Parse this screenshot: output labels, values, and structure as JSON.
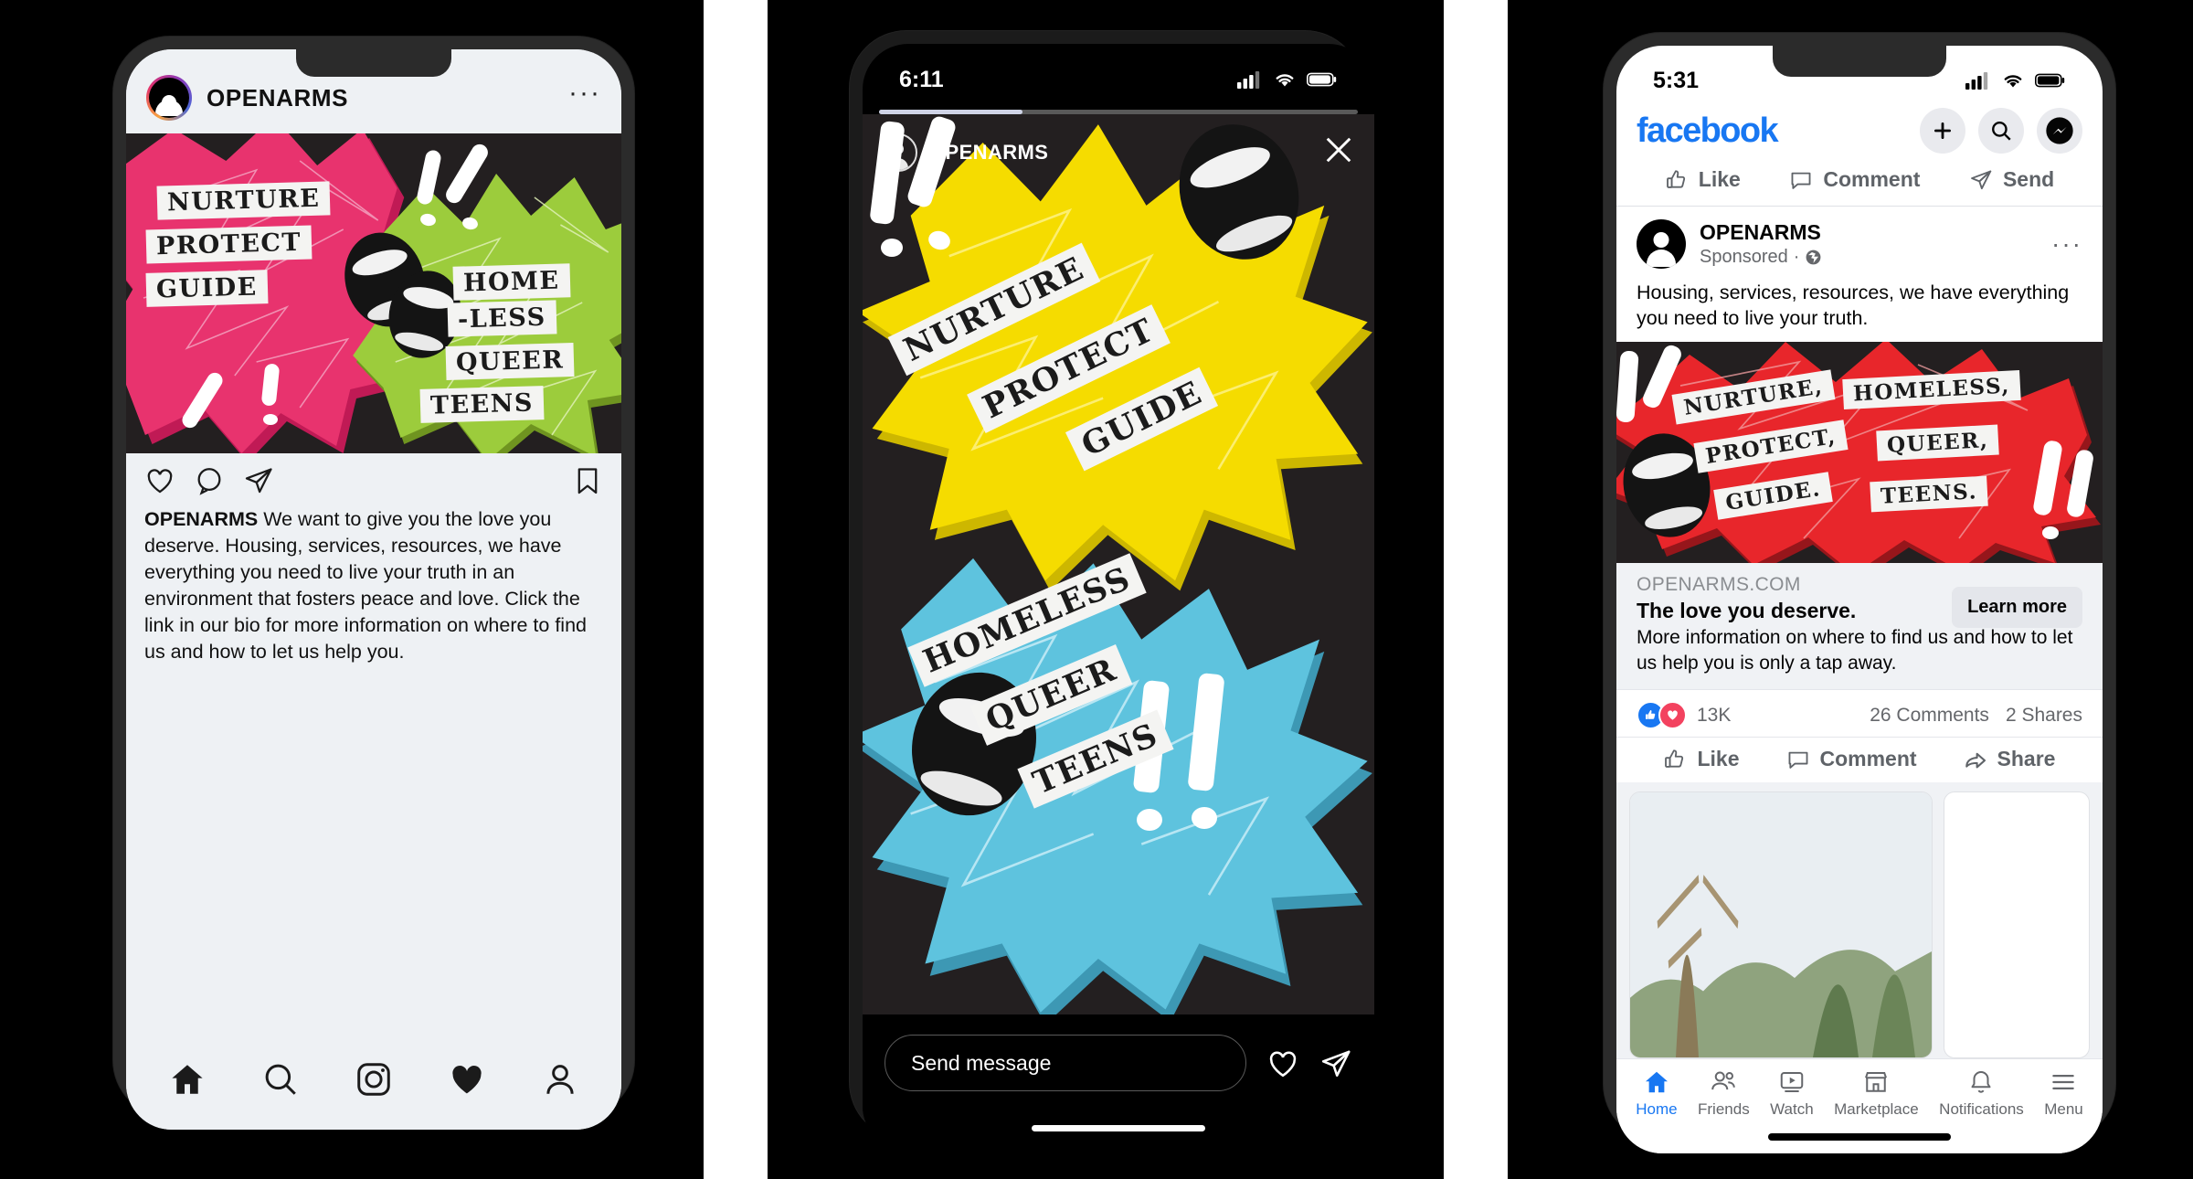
{
  "panels": {
    "instagram": {
      "name": "Instagram feed post mockup"
    },
    "story": {
      "name": "Instagram story mockup"
    },
    "facebook": {
      "name": "Facebook sponsored post mockup"
    }
  },
  "instagram": {
    "header": {
      "username": "OPENARMS",
      "more_label": "···"
    },
    "post": {
      "artwork": {
        "words_left": [
          "NURTURE",
          "PROTECT",
          "GUIDE"
        ],
        "words_right": [
          "HOME",
          "-LESS",
          "QUEER",
          "TEENS"
        ],
        "burst_left_color": "#e8336e",
        "burst_right_color": "#9ccc3c",
        "background_color": "#231f20"
      },
      "caption_author": "OPENARMS",
      "caption_body": " We want to give you the love you deserve. Housing, services, resources, we have everything you need to live your truth in an environment that fosters peace and love. Click the link in our bio for more information on where to find us and how to let us help you."
    },
    "actions": [
      "like-icon",
      "comment-icon",
      "share-icon",
      "bookmark-icon"
    ],
    "nav": [
      "home-icon",
      "search-icon",
      "reels-icon",
      "heart-icon",
      "profile-icon"
    ]
  },
  "story": {
    "status": {
      "time": "6:11",
      "signal": "signal-icon",
      "wifi": "wifi-icon",
      "battery": "battery-icon"
    },
    "progress_percent": 30,
    "header": {
      "username": "OPENARMS",
      "close_label": "✕"
    },
    "artwork": {
      "words_top": [
        "NURTURE",
        "PROTECT",
        "GUIDE"
      ],
      "words_bottom": [
        "HOMELESS",
        "QUEER",
        "TEENS"
      ],
      "burst_top_color": "#f5dc00",
      "burst_bottom_color": "#5ec3de",
      "background_color": "#231f20"
    },
    "footer": {
      "input_placeholder": "Send message",
      "like_icon": "heart-icon",
      "send_icon": "send-icon"
    }
  },
  "facebook": {
    "status": {
      "time": "5:31",
      "signal": "signal-icon",
      "wifi": "wifi-icon",
      "battery": "battery-icon"
    },
    "topbar": {
      "logo": "facebook",
      "add_icon": "plus-icon",
      "search_icon": "search-icon",
      "messenger_icon": "messenger-icon"
    },
    "quickbar": [
      {
        "icon": "thumbs-up-icon",
        "label": "Like"
      },
      {
        "icon": "comment-icon",
        "label": "Comment"
      },
      {
        "icon": "send-icon",
        "label": "Send"
      }
    ],
    "post": {
      "page_name": "OPENARMS",
      "sponsored_label": "Sponsored",
      "privacy_separator": "·",
      "privacy_icon": "globe-icon",
      "more_label": "···",
      "body": "Housing, services, resources, we have everything you need to live your truth.",
      "artwork": {
        "words_left": [
          "NURTURE,",
          "PROTECT,",
          "GUIDE."
        ],
        "words_right": [
          "HOMELESS,",
          "QUEER,",
          "TEENS."
        ],
        "burst_color": "#e8262b",
        "background_color": "#231f20"
      }
    },
    "link_card": {
      "domain": "OPENARMS.COM",
      "title": "The love you deserve.",
      "description": "More information on where to find us and how to let us help you is only a tap away.",
      "cta": "Learn more"
    },
    "stats": {
      "reaction_count": "13K",
      "comments": "26 Comments",
      "shares": "2 Shares"
    },
    "actions": [
      {
        "icon": "thumbs-up-icon",
        "label": "Like"
      },
      {
        "icon": "comment-icon",
        "label": "Comment"
      },
      {
        "icon": "share-icon",
        "label": "Share"
      }
    ],
    "nav": [
      {
        "icon": "home-icon",
        "label": "Home",
        "active": true
      },
      {
        "icon": "friends-icon",
        "label": "Friends",
        "active": false
      },
      {
        "icon": "watch-icon",
        "label": "Watch",
        "active": false
      },
      {
        "icon": "marketplace-icon",
        "label": "Marketplace",
        "active": false
      },
      {
        "icon": "notifications-icon",
        "label": "Notifications",
        "active": false
      },
      {
        "icon": "menu-icon",
        "label": "Menu",
        "active": false
      }
    ]
  }
}
